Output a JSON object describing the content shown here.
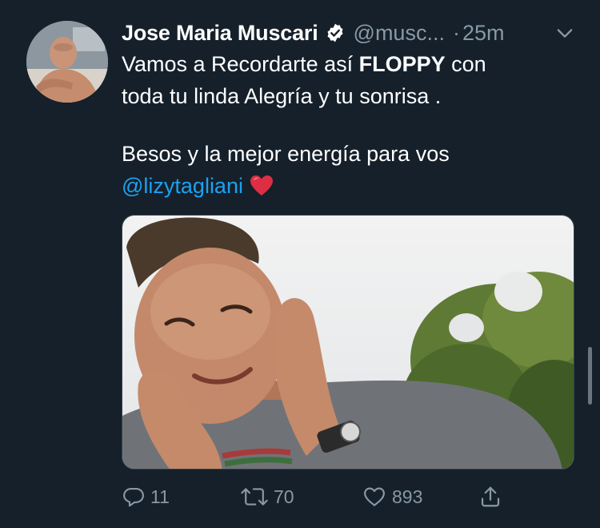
{
  "author": {
    "display_name": "Jose Maria Muscari",
    "handle": "@musc...",
    "separator": "·",
    "timestamp": "25m",
    "verified": true
  },
  "tweet": {
    "line1_pre": "Vamos a Recordarte así ",
    "line1_bold": "FLOPPY",
    "line1_post": " con",
    "line2": "toda tu linda Alegría y tu sonrisa .",
    "line3": "Besos y la mejor energía para vos",
    "mention": "@lizytagliani",
    "emoji": "red-heart"
  },
  "actions": {
    "replies": "11",
    "retweets": "70",
    "likes": "893"
  },
  "colors": {
    "background": "#15202b",
    "secondary_text": "#8899a6",
    "link": "#1da1f2",
    "verified_badge": "#ffffff"
  },
  "icons": [
    "verified-badge-icon",
    "chevron-down-icon",
    "reply-icon",
    "retweet-icon",
    "heart-icon",
    "share-icon"
  ]
}
